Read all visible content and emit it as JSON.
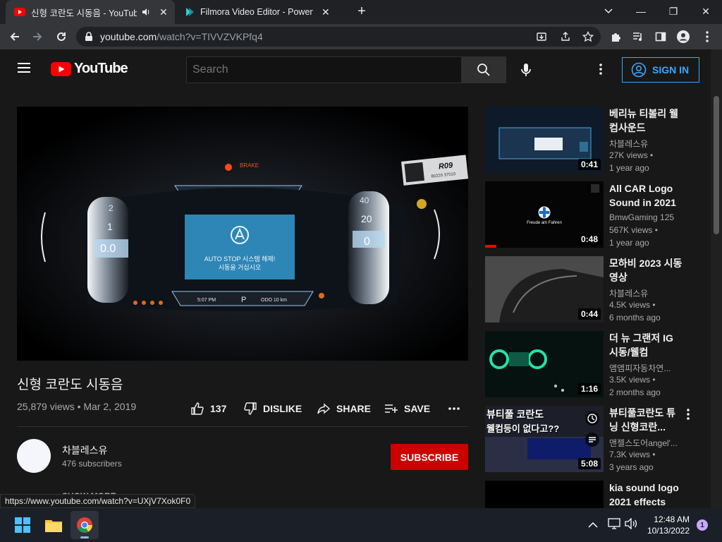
{
  "browser": {
    "tabs": [
      {
        "title": "신형 코란도 시동음 - YouTub",
        "active": true
      },
      {
        "title": "Filmora Video Editor - Powerful V",
        "active": false
      }
    ],
    "url_host": "youtube.com",
    "url_path": "/watch?v=TIVVZVKPfq4"
  },
  "youtube": {
    "logo_text": "YouTube",
    "search_placeholder": "Search",
    "signin_label": "SIGN IN",
    "video": {
      "title": "신형 코란도 시동음",
      "meta": "25,879 views • Mar 2, 2019",
      "likes": "137",
      "dislike_label": "DISLIKE",
      "share_label": "SHARE",
      "save_label": "SAVE",
      "overlay": {
        "brake": "BRAKE",
        "plate_code": "R09",
        "plate_num": "80220 37010",
        "screen_text_1": "AUTO STOP 시스템 해제!",
        "screen_text_2": "시동을 거십시오",
        "time": "5:07 PM",
        "gear": "P",
        "odo": "ODO 10 km",
        "left_gauge": [
          "2",
          "1",
          "0.0"
        ],
        "right_gauge": [
          "40",
          "20",
          "0"
        ]
      }
    },
    "channel": {
      "name": "차블레스유",
      "subscribers": "476 subscribers",
      "subscribe_label": "SUBSCRIBE",
      "show_more": "SHOW MORE"
    },
    "recommendations": [
      {
        "title": "베리뉴 티볼리 웰컴사운드",
        "channel": "차블레스유",
        "views": "27K views •",
        "age": "1 year ago",
        "duration": "0:41",
        "thumb_color": "#0e1a2a"
      },
      {
        "title": "All CAR Logo Sound in 2021",
        "channel": "BmwGaming 125",
        "views": "567K views •",
        "age": "1 year ago",
        "duration": "0:48",
        "thumb_color": "#050505",
        "thumb_text": "Freude am Fahren"
      },
      {
        "title": "모하비 2023 시동영상",
        "channel": "차블레스유",
        "views": "4.5K views •",
        "age": "6 months ago",
        "duration": "0:44",
        "thumb_color": "#2a2a2a"
      },
      {
        "title": "더 뉴 그랜저 IG 시동/웰컴",
        "channel": "앰앰피자동차연...",
        "views": "3.5K views •",
        "age": "2 months ago",
        "duration": "1:16",
        "thumb_color": "#05120f"
      },
      {
        "title": "뷰티풀코란도 튜닝 신형코란...",
        "channel": "앤젤스도어angel'...",
        "views": "7.3K views •",
        "age": "3 years ago",
        "duration": "5:08",
        "thumb_color": "#1c1f2a",
        "thumb_caption_1": "뷰티풀 코란도",
        "thumb_caption_2": "웰컴등이 없다고??"
      },
      {
        "title": "kia sound logo 2021 effects",
        "channel": "",
        "views": "",
        "age": "",
        "duration": "",
        "thumb_color": "#000000"
      }
    ],
    "status_url": "https://www.youtube.com/watch?v=UXjV7Xok0F0"
  },
  "taskbar": {
    "time": "12:48 AM",
    "date": "10/13/2022",
    "notifications": "1"
  },
  "colors": {
    "accent_blue": "#3ea6ff",
    "subscribe_red": "#cc0000",
    "youtube_red": "#ff0000"
  }
}
